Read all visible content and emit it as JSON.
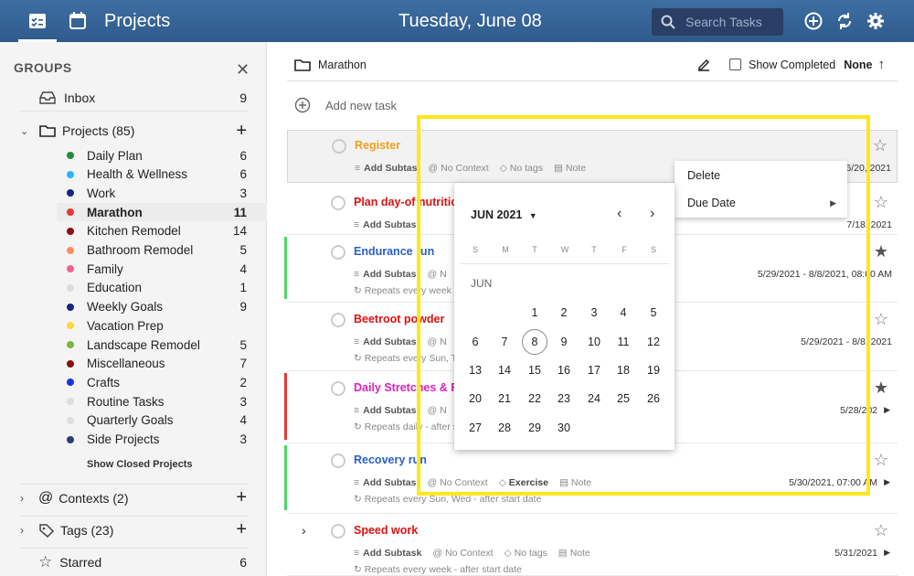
{
  "header": {
    "title": "Projects",
    "date": "Tuesday, June 08",
    "search_placeholder": "Search Tasks",
    "icons": [
      "tasks-icon",
      "calendar-icon",
      "add-icon",
      "sync-icon",
      "settings-icon"
    ]
  },
  "sidebar": {
    "groups_title": "GROUPS",
    "inbox": {
      "label": "Inbox",
      "count": "9"
    },
    "projects": {
      "label": "Projects (85)"
    },
    "project_items": [
      {
        "label": "Daily Plan",
        "count": "6",
        "color": "#1e8e3e"
      },
      {
        "label": "Health & Wellness",
        "count": "6",
        "color": "#29b6f6"
      },
      {
        "label": "Work",
        "count": "3",
        "color": "#1a237e"
      },
      {
        "label": "Marathon",
        "count": "11",
        "color": "#e53935"
      },
      {
        "label": "Kitchen Remodel",
        "count": "14",
        "color": "#8b1010"
      },
      {
        "label": "Bathroom Remodel",
        "count": "5",
        "color": "#ff8a65"
      },
      {
        "label": "Family",
        "count": "4",
        "color": "#f06292"
      },
      {
        "label": "Education",
        "count": "1",
        "color": "#dddddd"
      },
      {
        "label": "Weekly Goals",
        "count": "9",
        "color": "#1a237e"
      },
      {
        "label": "Vacation Prep",
        "count": "",
        "color": "#fdd835"
      },
      {
        "label": "Landscape Remodel",
        "count": "5",
        "color": "#7cb342"
      },
      {
        "label": "Miscellaneous",
        "count": "7",
        "color": "#8b1010"
      },
      {
        "label": "Crafts",
        "count": "2",
        "color": "#1a33dd"
      },
      {
        "label": "Routine Tasks",
        "count": "3",
        "color": "#dddddd"
      },
      {
        "label": "Quarterly Goals",
        "count": "4",
        "color": "#dddddd"
      },
      {
        "label": "Side Projects",
        "count": "3",
        "color": "#2c3e70"
      }
    ],
    "show_closed": "Show Closed Projects",
    "contexts": {
      "label": "Contexts (2)"
    },
    "tags": {
      "label": "Tags (23)"
    },
    "starred": {
      "label": "Starred",
      "count": "6"
    }
  },
  "main": {
    "breadcrumb": "Marathon",
    "show_completed": "Show Completed",
    "sort": "None",
    "add_task": "Add new task",
    "tasks": [
      {
        "name": "Register",
        "color": "#f0a020",
        "subtask": "Add Subtas",
        "context": "No Context",
        "tags": "No tags",
        "note": "Note",
        "due": "6/20, 2021"
      },
      {
        "name": "Plan day-of nutrition",
        "color": "#e01010",
        "subtask": "Add Subtas",
        "due": "7/18, 2021"
      },
      {
        "name": "Endurance run",
        "color": "#2a60c8",
        "subtask": "Add Subtas",
        "context": "N",
        "repeat": "Repeats every week -",
        "due": "5/29/2021 - 8/8/2021, 08:00 AM"
      },
      {
        "name": "Beetroot powder",
        "color": "#e01010",
        "subtask": "Add Subtas",
        "context": "N",
        "repeat": "Repeats every Sun, T",
        "due": "5/29/2021 - 8/8, 2021"
      },
      {
        "name": "Daily Stretches & Fo",
        "color": "#e020c0",
        "subtask": "Add Subtas",
        "context": "N",
        "repeat": "Repeats daily - after s",
        "due": "5/28/202"
      },
      {
        "name": "Recovery run",
        "color": "#2a60c8",
        "subtask": "Add Subtas",
        "context": "No Context",
        "tags": "Exercise",
        "note": "Note",
        "repeat": "Repeats every Sun, Wed - after start date",
        "due": "5/30/2021, 07:00 AM"
      },
      {
        "name": "Speed work",
        "color": "#e01010",
        "subtask": "Add Subtask",
        "context": "No Context",
        "tags": "No tags",
        "note": "Note",
        "repeat": "Repeats every week - after start date",
        "due": "5/31/2021"
      }
    ]
  },
  "context_menu": {
    "delete": "Delete",
    "due_date": "Due Date"
  },
  "calendar": {
    "month_label": "JUN 2021",
    "section_label": "JUN",
    "weekdays": [
      "S",
      "M",
      "T",
      "W",
      "T",
      "F",
      "S"
    ],
    "selected_day": "8"
  }
}
